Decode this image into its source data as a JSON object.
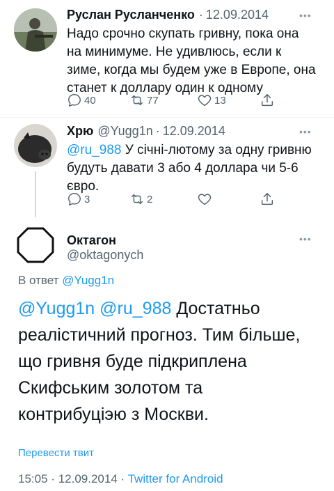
{
  "tweet1": {
    "author": "Руслан Русланченко",
    "sep": "·",
    "date": "12.09.2014",
    "more": "•••",
    "lines": [
      "Надо срочно скупать гривну, пока она",
      "на минимуме. Не удивлюсь, если к",
      "зиме, когда мы будем уже в Европе, она",
      "станет к доллару один к одному"
    ],
    "replies": "40",
    "retweets": "77",
    "likes": "13",
    "icons": [
      "comment-icon",
      "retweet-icon",
      "heart-icon",
      "share-icon"
    ]
  },
  "tweet2": {
    "author": "Хрю",
    "handle": "@Yugg1n",
    "sep": "·",
    "date": "12.09.2014",
    "more": "•••",
    "mention": "@ru_988",
    "line1_rest": " У січні-лютому за одну гривню",
    "line2": "будуть давати 3 або 4 доллара чи  5-6",
    "line3": "євро.",
    "replies": "3",
    "retweets": "2",
    "likes": ""
  },
  "tweet3": {
    "author": "Октагон",
    "handle": "@oktagonych",
    "more": "•••",
    "reply_to_label": "В ответ",
    "reply_to_handle": "@Yugg1n",
    "mention1": "@Yugg1n",
    "mention2": "@ru_988",
    "line1_rest": " Достатньо",
    "line2": "реалістичний прогноз. Тим більше,",
    "line3": "що гривня буде підкриплена",
    "line4": "Скифським золотом та",
    "line5": "контрибуціэю з Москви.",
    "translate": "Перевести твит",
    "time": "15:05",
    "sep": "·",
    "date": "12.09.2014",
    "client": "Twitter for Android"
  },
  "colors": {
    "accent": "#1d9bf0",
    "muted": "#536471",
    "text": "#0f1419"
  }
}
